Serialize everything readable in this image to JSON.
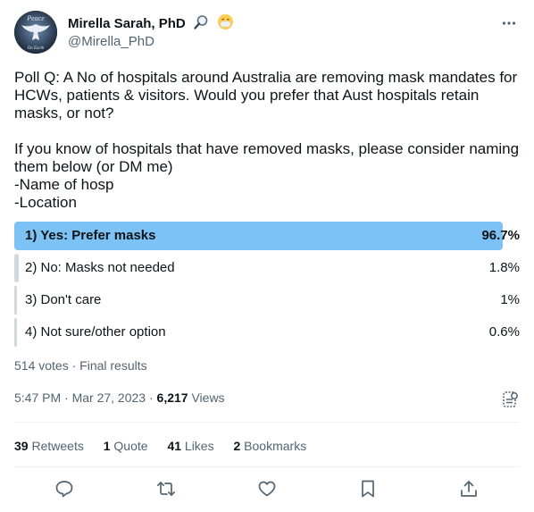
{
  "author": {
    "display_name": "Mirella Sarah, PhD",
    "handle": "@Mirella_PhD",
    "avatar_text_top": "Peace",
    "avatar_text_bottom": "On Earth"
  },
  "tweet": {
    "text": "Poll Q: A No of hospitals around Australia are removing mask mandates for HCWs, patients & visitors. Would you prefer that Aust hospitals retain masks, or not?\n\nIf you know of hospitals that have removed masks, please consider naming them below (or DM me)\n-Name of hosp\n-Location"
  },
  "poll": {
    "options": [
      {
        "label": "1) Yes: Prefer masks",
        "percent_text": "96.7%",
        "percent": 96.7,
        "winner": true
      },
      {
        "label": "2) No: Masks not needed",
        "percent_text": "1.8%",
        "percent": 1.8,
        "winner": false
      },
      {
        "label": "3) Don't care",
        "percent_text": "1%",
        "percent": 1,
        "winner": false
      },
      {
        "label": "4) Not sure/other option",
        "percent_text": "0.6%",
        "percent": 0.6,
        "winner": false
      }
    ],
    "meta": "514 votes · Final results",
    "colors": {
      "winner": "#7cc2f4",
      "other": "#cfd9de"
    }
  },
  "timestamp": {
    "time_date": "5:47 PM · Mar 27, 2023 · ",
    "views_count": "6,217",
    "views_label": " Views"
  },
  "stats": {
    "retweets_count": "39",
    "retweets_label": "Retweets",
    "quotes_count": "1",
    "quotes_label": "Quote",
    "likes_count": "41",
    "likes_label": "Likes",
    "bookmarks_count": "2",
    "bookmarks_label": "Bookmarks"
  },
  "icons": [
    "more-icon",
    "magnifier-emoji",
    "mask-emoji",
    "analytics-icon",
    "reply-icon",
    "retweet-icon",
    "like-icon",
    "bookmark-icon",
    "share-icon"
  ]
}
